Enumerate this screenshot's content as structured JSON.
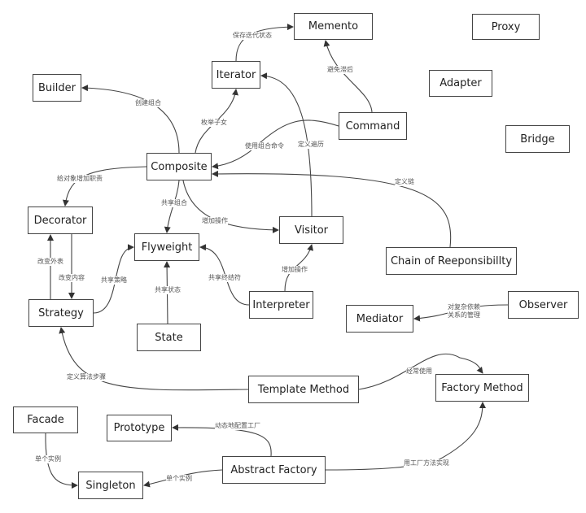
{
  "nodes": {
    "memento": "Memento",
    "proxy": "Proxy",
    "iterator": "Iterator",
    "builder": "Builder",
    "adapter": "Adapter",
    "command": "Command",
    "bridge": "Bridge",
    "composite": "Composite",
    "decorator": "Decorator",
    "visitor": "Visitor",
    "flyweight": "Flyweight",
    "chain": "Chain of Reeponsibillty",
    "interpreter": "Interpreter",
    "observer": "Observer",
    "mediator": "Mediator",
    "strategy": "Strategy",
    "state": "State",
    "template_method": "Template Method",
    "factory_method": "Factory Method",
    "facade": "Facade",
    "prototype": "Prototype",
    "abstract_factory": "Abstract Factory",
    "singleton": "Singleton"
  },
  "edges": {
    "iterator_memento": "保存迭代状态",
    "command_memento": "避免滞后",
    "composite_builder": "创建组合",
    "composite_iterator": "枚举子女",
    "command_composite": "使用组合命令",
    "visitor_iterator": "定义遍历",
    "composite_decorator": "给对象增加职责",
    "composite_flyweight": "共享组合",
    "composite_visitor": "增加操作",
    "chain_composite": "定义链",
    "strategy_decorator": "改变外表",
    "decorator_strategy": "改变内容",
    "strategy_flyweight": "共享策略",
    "state_flyweight": "共享状态",
    "interpreter_flyweight": "共享终结符",
    "interpreter_visitor": "增加操作",
    "observer_mediator": "对复杂依赖\n关系的管理",
    "template_strategy": "定义算法步骤",
    "template_factory": "经常使用",
    "abstract_prototype": "动态地配置工厂",
    "facade_singleton": "单个实例",
    "abstract_singleton": "单个实例",
    "abstract_factory_method": "用工厂方法实现"
  },
  "colors": {
    "stroke": "#444444",
    "label": "#555555"
  }
}
